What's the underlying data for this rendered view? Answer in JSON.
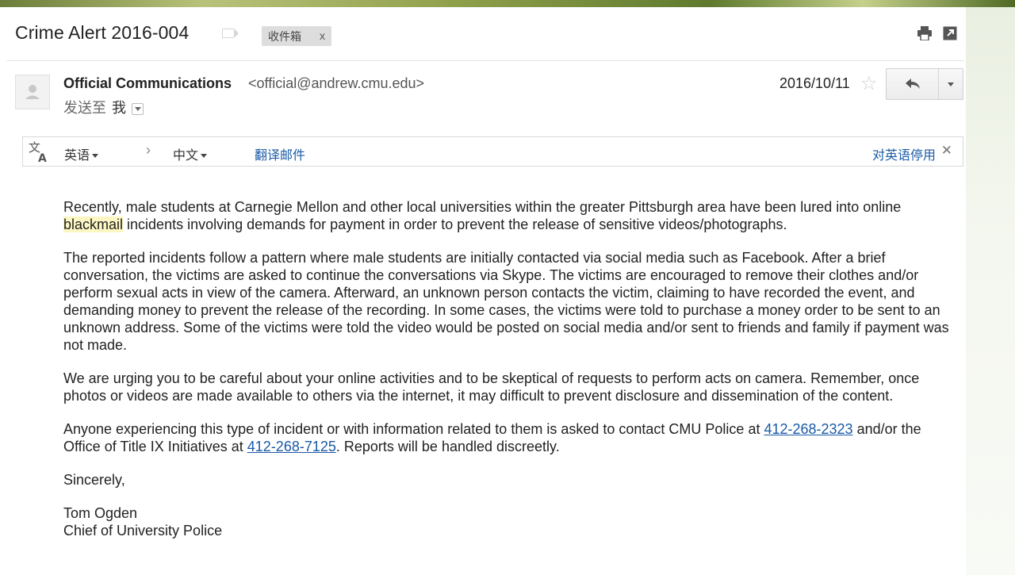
{
  "email": {
    "subject": "Crime Alert 2016-004",
    "label_chip": "收件箱",
    "label_chip_close": "x",
    "sender_name": "Official Communications",
    "sender_email": "<official@andrew.cmu.edu>",
    "to_prefix": "发送至",
    "to_recipient": "我",
    "date": "2016/10/11",
    "star": "☆"
  },
  "translate_bar": {
    "source_language": "英语",
    "target_language": "中文",
    "translate_link": "翻译邮件",
    "stop_link": "对英语停用",
    "close": "✕",
    "arrow": "›"
  },
  "body": {
    "p1_before": "Recently, male students at Carnegie Mellon and other local universities within the greater Pittsburgh area have been lured into online ",
    "p1_highlight": "blackmail",
    "p1_after": " incidents involving demands for payment in order to prevent the release of sensitive videos/photographs.",
    "p2": "The reported incidents follow a pattern where male students are initially contacted via social media such as Facebook. After a brief conversation, the victims are asked to continue the conversations via Skype. The victims are encouraged to remove their clothes and/or perform sexual acts in view of the camera. Afterward, an unknown person contacts the victim, claiming to have recorded the event, and demanding money to prevent the release of the recording. In some cases, the victims were told to purchase a money order to be sent to an unknown address. Some of the victims were told the video would be posted on social media and/or sent to friends and family if payment was not made.",
    "p3": "We are urging you to be careful about your online activities and to be skeptical of requests to perform acts on camera. Remember, once photos or videos are made available to others via the internet, it may difficult to prevent disclosure and dissemination of the content.",
    "p4_part1": "Anyone experiencing this type of incident or with information related to them is asked to contact CMU Police at ",
    "p4_phone1": "412-268-2323",
    "p4_part2": " and/or the Office of Title IX Initiatives at ",
    "p4_phone2": "412-268-7125",
    "p4_part3": ". Reports will be handled discreetly.",
    "closing": "Sincerely,",
    "signature_name": "Tom Ogden",
    "signature_title": "Chief of University Police"
  },
  "icons": {
    "print": "print-icon",
    "new_window": "new-window-icon",
    "reply": "reply-icon",
    "more": "chevron-down-icon",
    "translate": "translate-icon",
    "avatar": "avatar-icon"
  },
  "colors": {
    "link": "#1a5aa6",
    "highlight": "#fcf7c2",
    "text": "#222222"
  }
}
